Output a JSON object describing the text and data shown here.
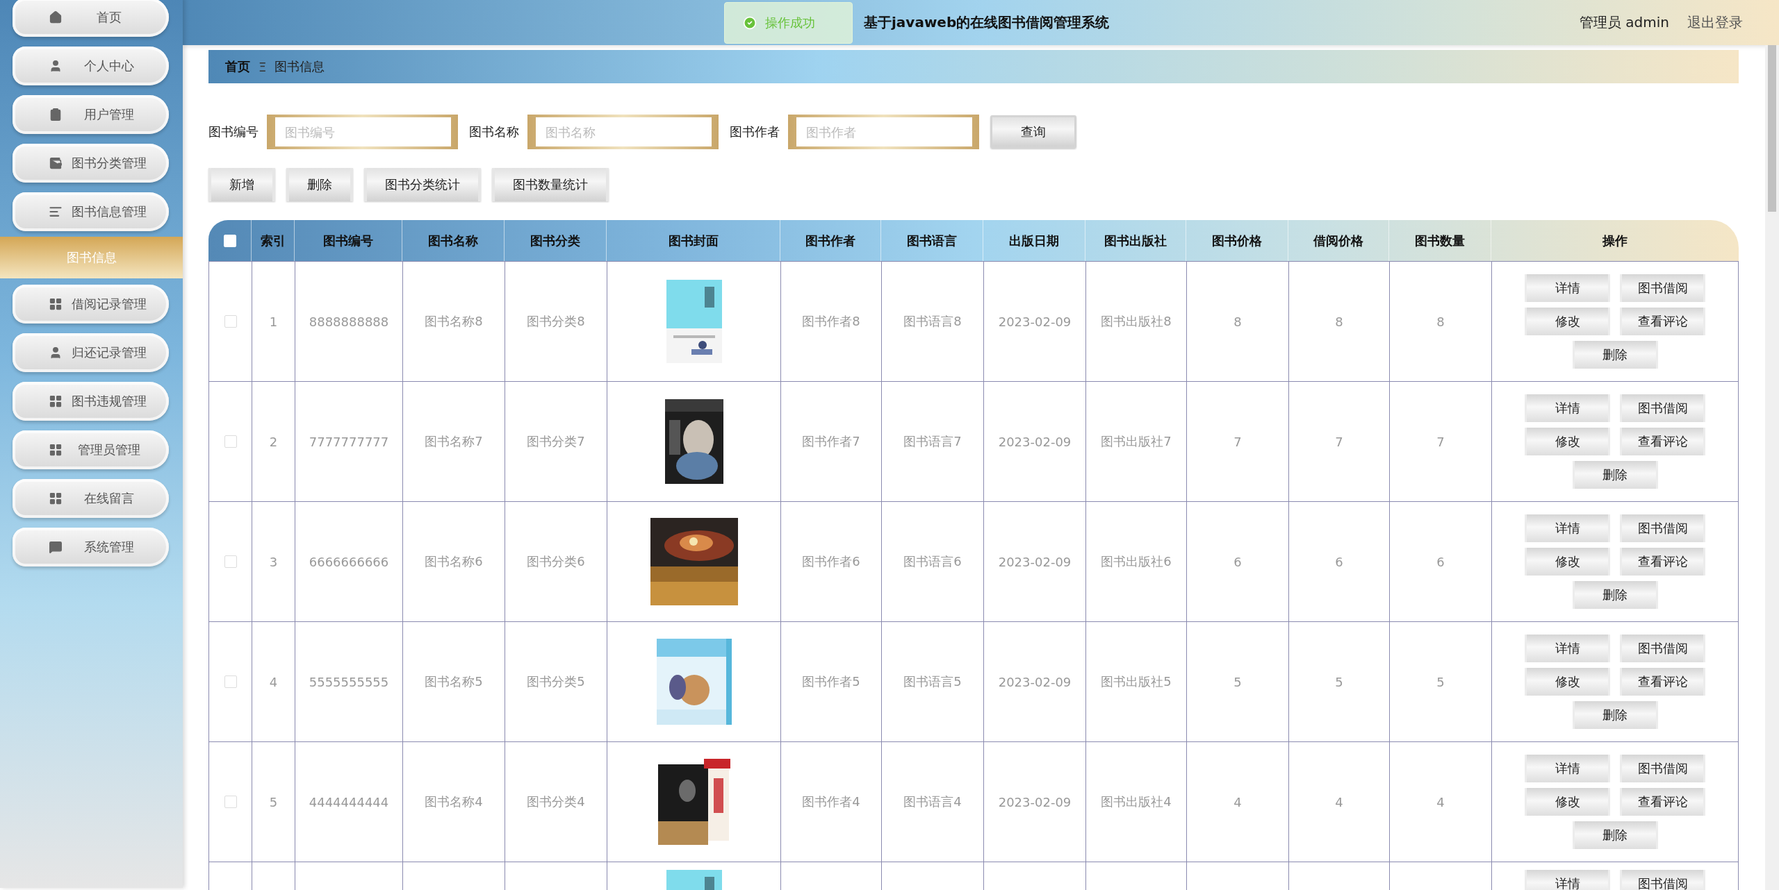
{
  "sidebar": {
    "items": [
      {
        "label": "首页",
        "selected": false
      },
      {
        "label": "个人中心",
        "selected": false
      },
      {
        "label": "用户管理",
        "selected": false
      },
      {
        "label": "图书分类管理",
        "selected": false
      },
      {
        "label": "图书信息管理",
        "selected": false,
        "expanded": true,
        "children": [
          {
            "label": "图书信息",
            "selected": true
          }
        ]
      },
      {
        "label": "借阅记录管理",
        "selected": false
      },
      {
        "label": "归还记录管理",
        "selected": false
      },
      {
        "label": "图书违规管理",
        "selected": false
      },
      {
        "label": "管理员管理",
        "selected": false
      },
      {
        "label": "在线留言",
        "selected": false
      },
      {
        "label": "系统管理",
        "selected": false
      }
    ]
  },
  "header": {
    "title": "基于javaweb的在线图书借阅管理系统",
    "user": "管理员 admin",
    "logout": "退出登录"
  },
  "toast": {
    "message": "操作成功"
  },
  "breadcrumb": {
    "items": [
      "首页",
      "图书信息"
    ],
    "separator": "Ξ"
  },
  "search": {
    "fields": [
      {
        "label": "图书编号",
        "placeholder": "图书编号"
      },
      {
        "label": "图书名称",
        "placeholder": "图书名称"
      },
      {
        "label": "图书作者",
        "placeholder": "图书作者"
      }
    ],
    "button": "查询"
  },
  "actions": [
    "新增",
    "删除",
    "图书分类统计",
    "图书数量统计"
  ],
  "table": {
    "select_all_checked": false,
    "columns": [
      "索引",
      "图书编号",
      "图书名称",
      "图书分类",
      "图书封面",
      "图书作者",
      "图书语言",
      "出版日期",
      "图书出版社",
      "图书价格",
      "借阅价格",
      "图书数量",
      "操作"
    ],
    "rows": [
      {
        "checked": false,
        "index": "1",
        "code": "8888888888",
        "name": "图书名称8",
        "category": "图书分类8",
        "cover": {
          "kind": "picture"
        },
        "author": "图书作者8",
        "language": "图书语言8",
        "date": "2023-02-09",
        "publisher": "图书出版社8",
        "price": "8",
        "borrow_price": "8",
        "quantity": "8",
        "actions": [
          "详情",
          "图书借阅",
          "修改",
          "查看评论",
          "删除"
        ]
      },
      {
        "checked": false,
        "index": "2",
        "code": "7777777777",
        "name": "图书名称7",
        "category": "图书分类7",
        "cover": {
          "kind": "picture"
        },
        "author": "图书作者7",
        "language": "图书语言7",
        "date": "2023-02-09",
        "publisher": "图书出版社7",
        "price": "7",
        "borrow_price": "7",
        "quantity": "7",
        "actions": [
          "详情",
          "图书借阅",
          "修改",
          "查看评论",
          "删除"
        ]
      },
      {
        "checked": false,
        "index": "3",
        "code": "6666666666",
        "name": "图书名称6",
        "category": "图书分类6",
        "cover": {
          "kind": "picture"
        },
        "author": "图书作者6",
        "language": "图书语言6",
        "date": "2023-02-09",
        "publisher": "图书出版社6",
        "price": "6",
        "borrow_price": "6",
        "quantity": "6",
        "actions": [
          "详情",
          "图书借阅",
          "修改",
          "查看评论",
          "删除"
        ]
      },
      {
        "checked": false,
        "index": "4",
        "code": "5555555555",
        "name": "图书名称5",
        "category": "图书分类5",
        "cover": {
          "kind": "picture"
        },
        "author": "图书作者5",
        "language": "图书语言5",
        "date": "2023-02-09",
        "publisher": "图书出版社5",
        "price": "5",
        "borrow_price": "5",
        "quantity": "5",
        "actions": [
          "详情",
          "图书借阅",
          "修改",
          "查看评论",
          "删除"
        ]
      },
      {
        "checked": false,
        "index": "5",
        "code": "4444444444",
        "name": "图书名称4",
        "category": "图书分类4",
        "cover": {
          "kind": "picture"
        },
        "author": "图书作者4",
        "language": "图书语言4",
        "date": "2023-02-09",
        "publisher": "图书出版社4",
        "price": "4",
        "borrow_price": "4",
        "quantity": "4",
        "actions": [
          "详情",
          "图书借阅",
          "修改",
          "查看评论",
          "删除"
        ]
      },
      {
        "cover": {
          "kind": "picture"
        },
        "actions": [
          "详情",
          "图书借阅"
        ]
      }
    ]
  }
}
